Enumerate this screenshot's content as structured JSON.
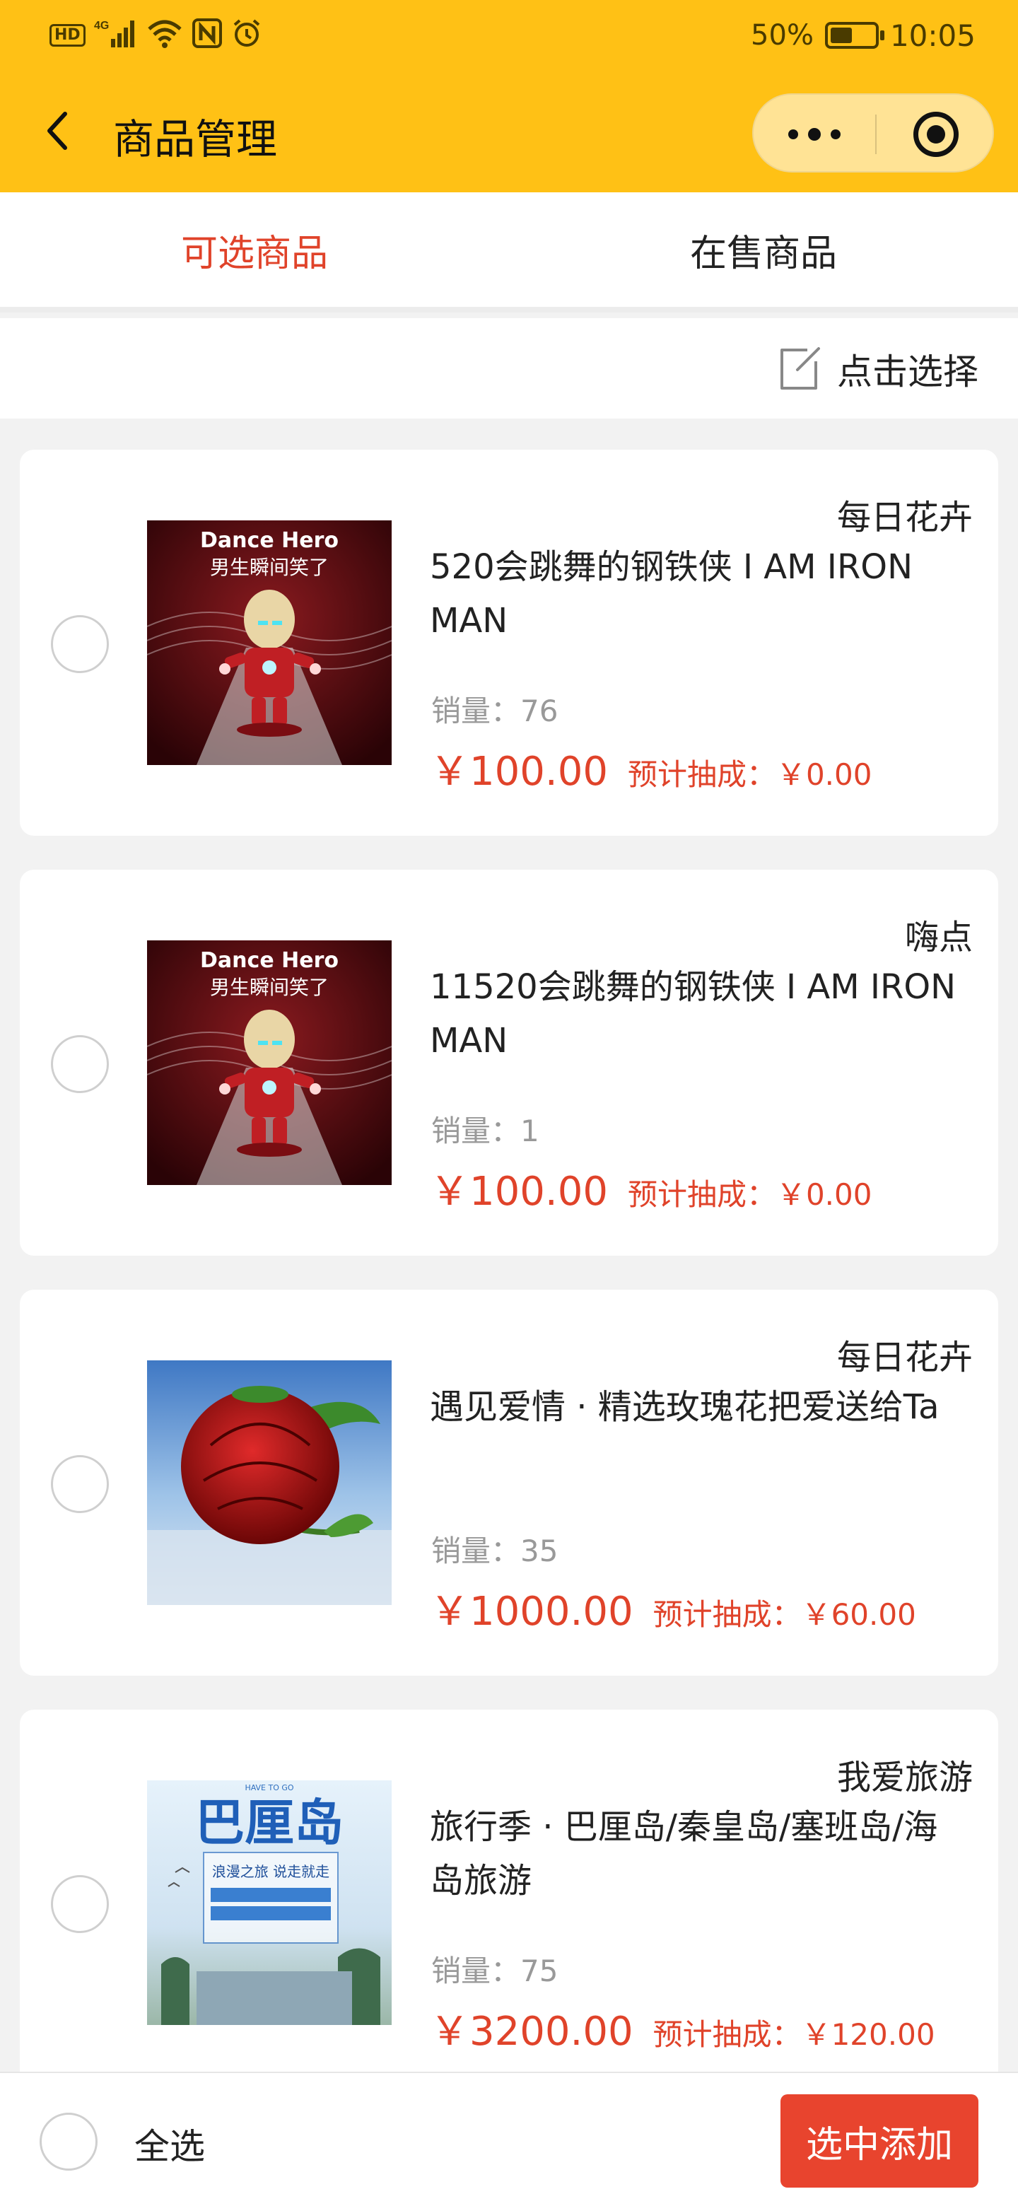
{
  "status_bar": {
    "signal_label": "4G",
    "hd_label": "HD",
    "battery_percent": "50%",
    "battery_level": 0.5,
    "time": "10:05",
    "icons": [
      "hd-icon",
      "signal-icon",
      "wifi-icon",
      "nfc-icon",
      "alarm-icon",
      "battery-icon"
    ]
  },
  "header": {
    "title": "商品管理",
    "background": "#ffc115"
  },
  "tabs": [
    {
      "label": "可选商品",
      "active": true
    },
    {
      "label": "在售商品",
      "active": false
    }
  ],
  "select_bar": {
    "label": "点击选择"
  },
  "products": [
    {
      "shop": "每日花卉",
      "name": "520会跳舞的钢铁侠 I AM IRON MAN",
      "sales": "销量：76",
      "price": "￥100.00",
      "commission": "预计抽成：￥0.00",
      "image": {
        "kind": "ironman",
        "title": "Dance Hero",
        "subtitle": "男生瞬间笑了"
      }
    },
    {
      "shop": "嗨点",
      "name": "11520会跳舞的钢铁侠 I AM IRON MAN",
      "sales": "销量：1",
      "price": "￥100.00",
      "commission": "预计抽成：￥0.00",
      "image": {
        "kind": "ironman",
        "title": "Dance Hero",
        "subtitle": "男生瞬间笑了"
      }
    },
    {
      "shop": "每日花卉",
      "name": "遇见爱情 · 精选玫瑰花把爱送给Ta",
      "sales": "销量：35",
      "price": "￥1000.00",
      "commission": "预计抽成：￥60.00",
      "image": {
        "kind": "rose"
      }
    },
    {
      "shop": "我爱旅游",
      "name": "旅行季 · 巴厘岛/秦皇岛/塞班岛/海岛旅游",
      "sales": "销量：75",
      "price": "￥3200.00",
      "commission": "预计抽成：￥120.00",
      "image": {
        "kind": "travel",
        "top_text": "HAVE TO GO",
        "title": "巴厘岛",
        "tagline": "浪漫之旅 说走就走"
      }
    }
  ],
  "bottom_bar": {
    "select_all_label": "全选",
    "add_button_label": "选中添加"
  },
  "colors": {
    "accent": "#e0432a",
    "header_bg": "#ffc115",
    "page_bg": "#f2f2f2"
  }
}
